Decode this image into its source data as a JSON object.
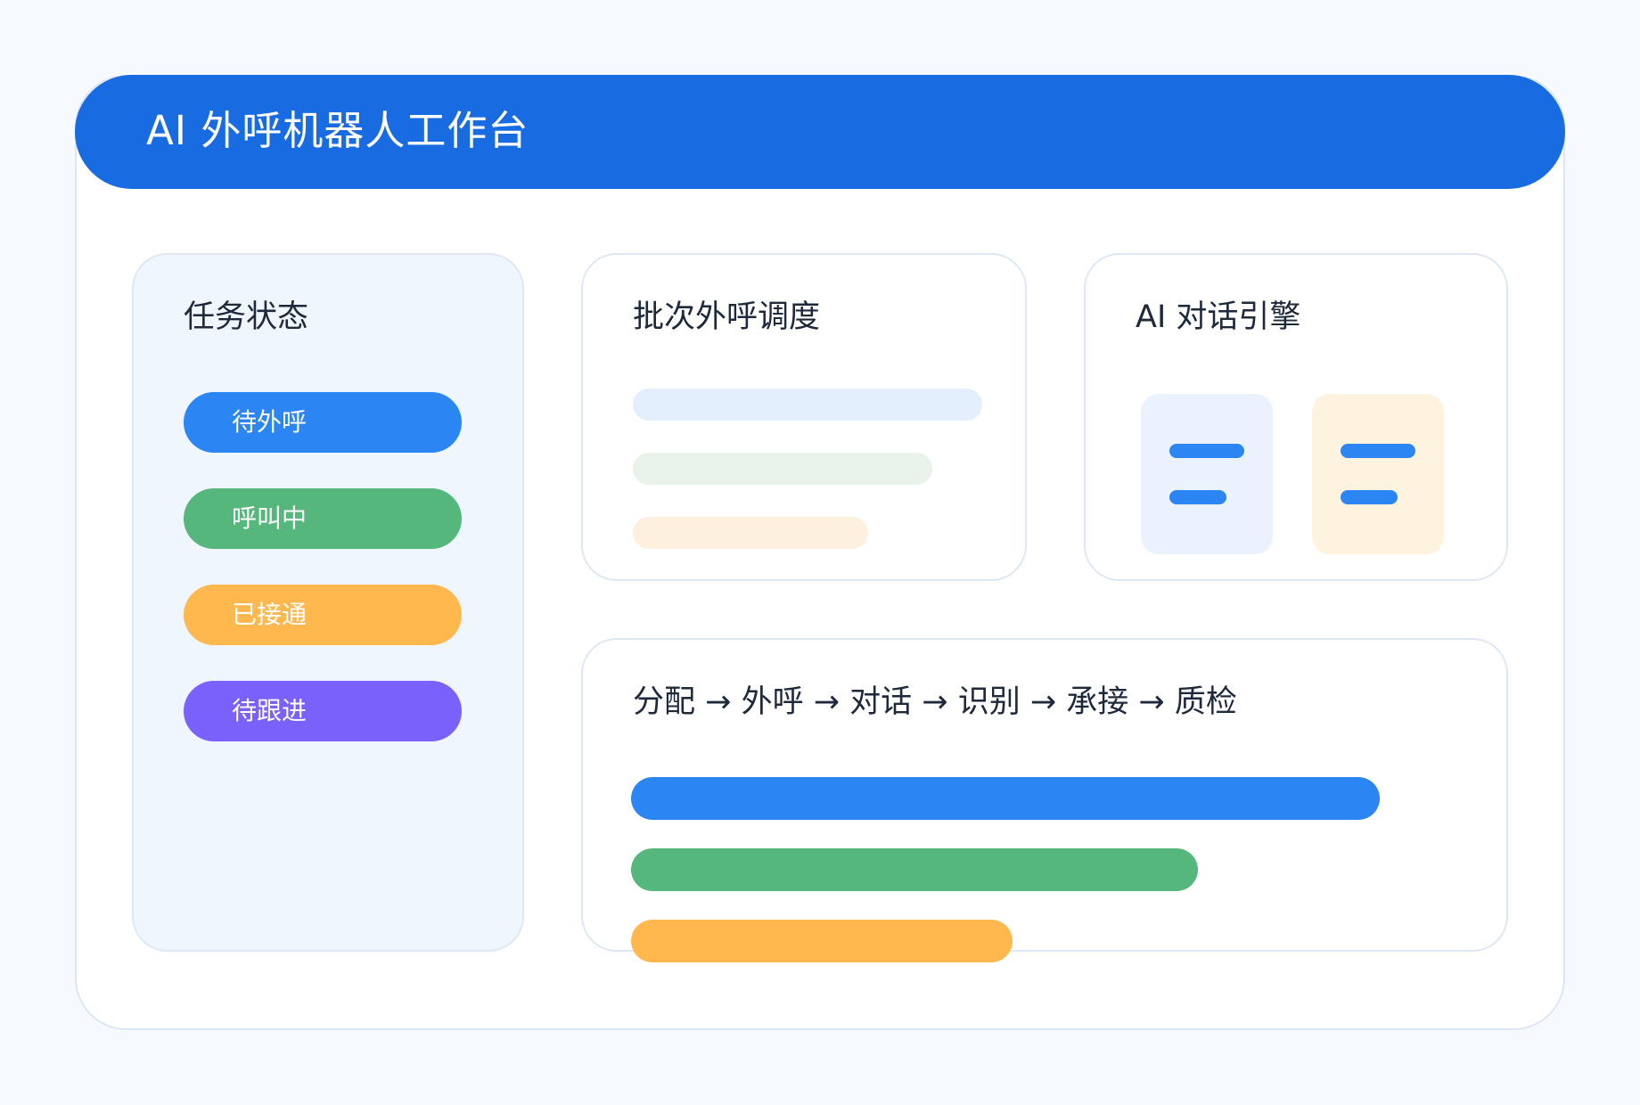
{
  "header": {
    "title": "AI 外呼机器人工作台",
    "color": "#186be0"
  },
  "status_card": {
    "title": "任务状态",
    "items": [
      {
        "label": "待外呼",
        "color": "#2b86f4"
      },
      {
        "label": "呼叫中",
        "color": "#55b77b"
      },
      {
        "label": "已接通",
        "color": "#ffb84d"
      },
      {
        "label": "待跟进",
        "color": "#7b61fb"
      }
    ]
  },
  "batch_card": {
    "title": "批次外呼调度",
    "placeholder_colors": [
      "#e3effc",
      "#e9f3ec",
      "#fdf0de"
    ]
  },
  "engine_card": {
    "title": "AI 对话引擎",
    "bubble_colors": [
      "#eaf3fd",
      "#fef3df"
    ]
  },
  "flow_card": {
    "title": "分配 → 外呼 → 对话 → 识别 → 承接 → 质检",
    "bars": [
      {
        "color": "#2b86f4",
        "level": 1.0
      },
      {
        "color": "#55b77b",
        "level": 0.76
      },
      {
        "color": "#ffb84d",
        "level": 0.51
      }
    ]
  }
}
